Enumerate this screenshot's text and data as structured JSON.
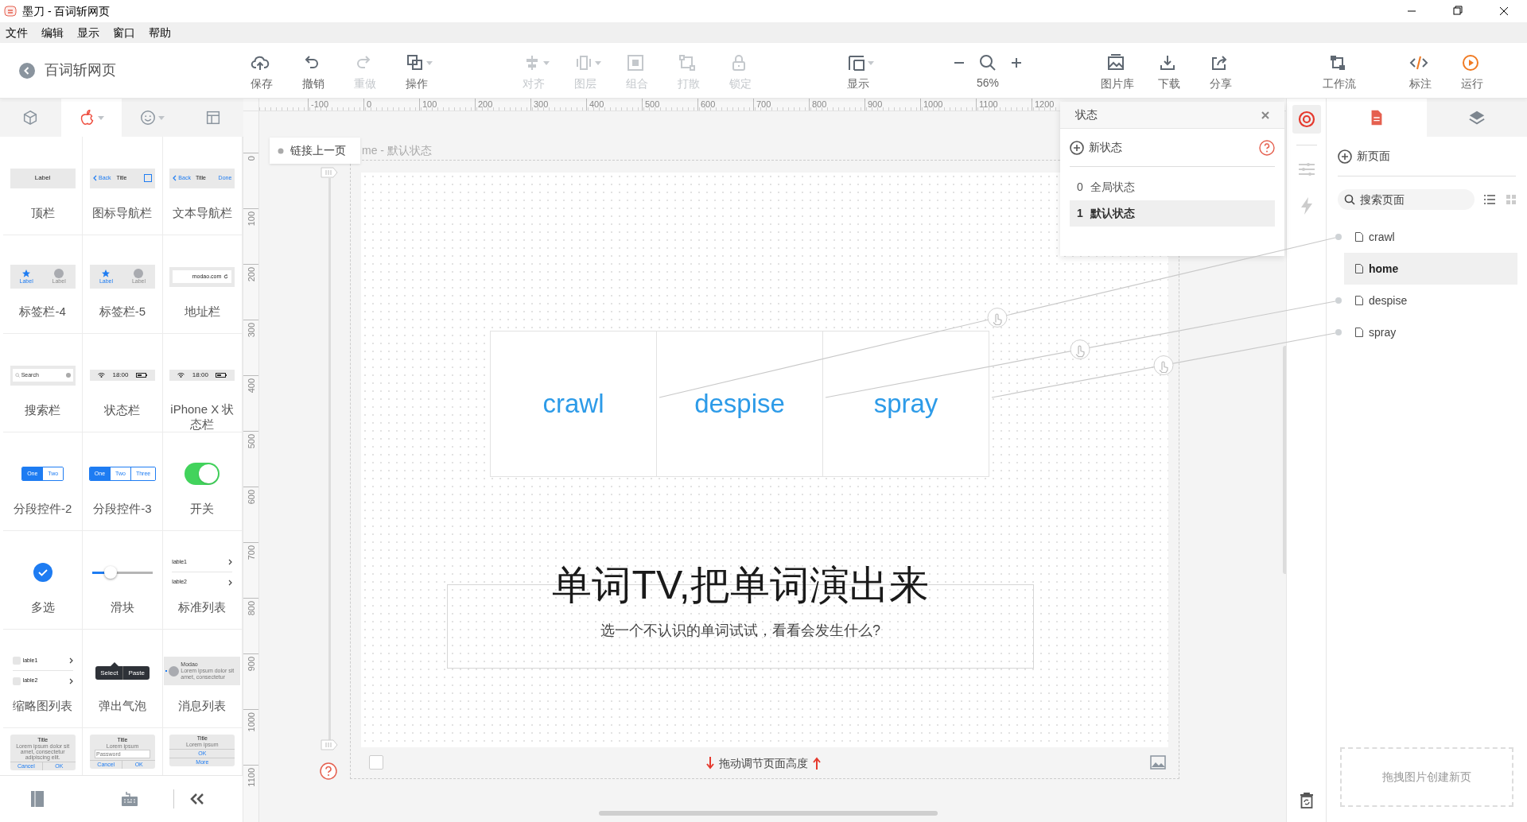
{
  "window": {
    "title": "墨刀 - 百词斩网页"
  },
  "menu": [
    "文件",
    "编辑",
    "显示",
    "窗口",
    "帮助"
  ],
  "header": {
    "back_label": "百词斩网页"
  },
  "toolbar": {
    "edit": [
      {
        "label": "保存",
        "disabled": false,
        "dropdown": false
      },
      {
        "label": "撤销",
        "disabled": false,
        "dropdown": false
      },
      {
        "label": "重做",
        "disabled": true,
        "dropdown": false
      },
      {
        "label": "操作",
        "disabled": false,
        "dropdown": true
      }
    ],
    "arrange": [
      {
        "label": "对齐",
        "disabled": true,
        "dropdown": true
      },
      {
        "label": "图层",
        "disabled": true,
        "dropdown": true
      },
      {
        "label": "组合",
        "disabled": true,
        "dropdown": false
      },
      {
        "label": "打散",
        "disabled": true,
        "dropdown": false
      },
      {
        "label": "锁定",
        "disabled": true,
        "dropdown": false
      }
    ],
    "view": [
      {
        "label": "显示",
        "disabled": false,
        "dropdown": true
      }
    ],
    "zoom": "56%",
    "assets": [
      {
        "label": "图片库",
        "disabled": false,
        "dropdown": false
      },
      {
        "label": "下载",
        "disabled": false,
        "dropdown": false
      },
      {
        "label": "分享",
        "disabled": false,
        "dropdown": false
      }
    ],
    "flow": [
      {
        "label": "工作流",
        "disabled": false,
        "dropdown": false
      }
    ],
    "output": [
      {
        "label": "标注",
        "disabled": false,
        "dropdown": false
      },
      {
        "label": "运行",
        "disabled": false,
        "dropdown": false
      }
    ]
  },
  "library_tabs": [
    {
      "selected": false
    },
    {
      "selected": true
    },
    {
      "selected": false
    },
    {
      "selected": false
    }
  ],
  "components": [
    {
      "kind": "top-bar",
      "label": "顶栏",
      "texts": [
        "Label"
      ]
    },
    {
      "kind": "icon-nav",
      "label": "图标导航栏",
      "texts": [
        "Back",
        "Title"
      ]
    },
    {
      "kind": "text-nav",
      "label": "文本导航栏",
      "texts": [
        "Back",
        "Title",
        "Done"
      ]
    },
    {
      "kind": "tab-bar",
      "label": "标签栏-4",
      "tabs": [
        {
          "text": "Label",
          "selected": true
        },
        {
          "text": "Label",
          "selected": false
        }
      ]
    },
    {
      "kind": "tab-bar",
      "label": "标签栏-5",
      "tabs": [
        {
          "text": "Label",
          "selected": true
        },
        {
          "text": "Label",
          "selected": false
        }
      ]
    },
    {
      "kind": "address",
      "label": "地址栏",
      "texts": [
        "modao.com"
      ]
    },
    {
      "kind": "search",
      "label": "搜索栏",
      "texts": [
        "Search"
      ]
    },
    {
      "kind": "status",
      "label": "状态栏",
      "texts": [
        "18:00"
      ]
    },
    {
      "kind": "status",
      "label": "iPhone X 状态栏",
      "texts": [
        "18:00"
      ]
    },
    {
      "kind": "segmented",
      "label": "分段控件-2",
      "segments": [
        {
          "text": "One",
          "selected": true
        },
        {
          "text": "Two",
          "selected": false
        }
      ]
    },
    {
      "kind": "segmented",
      "label": "分段控件-3",
      "segments": [
        {
          "text": "One",
          "selected": true
        },
        {
          "text": "Two",
          "selected": false
        },
        {
          "text": "Three",
          "selected": false
        }
      ]
    },
    {
      "kind": "switch",
      "label": "开关",
      "on": true
    },
    {
      "kind": "checkbox",
      "label": "多选",
      "checked": true
    },
    {
      "kind": "slider",
      "label": "滑块",
      "level": 0.3
    },
    {
      "kind": "list",
      "label": "标准列表",
      "texts": [
        "lable1",
        "lable2"
      ]
    },
    {
      "kind": "thumb-list",
      "label": "缩略图列表",
      "texts": [
        "lable1",
        "lable2"
      ]
    },
    {
      "kind": "popover",
      "label": "弹出气泡",
      "texts": [
        "Select",
        "Paste"
      ]
    },
    {
      "kind": "message",
      "label": "消息列表",
      "texts": [
        "Modao",
        "Lorem ipsum dolor sit amet, consectetur"
      ]
    },
    {
      "kind": "alert",
      "texts": [
        "Title",
        "Lorem ipsum dolor sit amet, consectetur adipiscing elit.",
        "Cancel",
        "OK"
      ]
    },
    {
      "kind": "prompt",
      "texts": [
        "Title",
        "Lorem ipsum",
        "Password",
        "Cancel",
        "OK"
      ]
    },
    {
      "kind": "action",
      "texts": [
        "Title",
        "Lorem ipsum",
        "OK",
        "More"
      ]
    }
  ],
  "rulers": {
    "horizontal": [
      "-100",
      "0",
      "100",
      "200",
      "300",
      "400",
      "500",
      "600",
      "700",
      "800",
      "900",
      "1000",
      "1100",
      "1200"
    ],
    "vertical": [
      "0",
      "100",
      "200",
      "300",
      "400",
      "500",
      "600",
      "700",
      "800",
      "900",
      "1000",
      "1100"
    ]
  },
  "canvas": {
    "link_prev": "链接上一页",
    "bottom_checkbox": {
      "checked": false
    },
    "page_caption": "me - 默认状态",
    "cards": [
      {
        "word": "crawl"
      },
      {
        "word": "despise"
      },
      {
        "word": "spray"
      }
    ],
    "headline": "单词TV,把单词演出来",
    "subtitle": "选一个不认识的单词试试，看看会发生什么?",
    "resize_hint": "拖动调节页面高度"
  },
  "states_panel": {
    "title": "状态",
    "new_label": "新状态",
    "states": [
      {
        "index": "0",
        "name": "全局状态",
        "selected": false
      },
      {
        "index": "1",
        "name": "默认状态",
        "selected": true
      }
    ]
  },
  "pages_panel": {
    "tabs": [
      {
        "selected": true
      },
      {
        "selected": false
      }
    ],
    "new_label": "新页面",
    "search_placeholder": "搜索页面",
    "pages": [
      {
        "name": "crawl",
        "selected": false,
        "linked": true
      },
      {
        "name": "home",
        "selected": true,
        "linked": false
      },
      {
        "name": "despise",
        "selected": false,
        "linked": true
      },
      {
        "name": "spray",
        "selected": false,
        "linked": true
      }
    ],
    "drop_hint": "拖拽图片创建新页"
  }
}
